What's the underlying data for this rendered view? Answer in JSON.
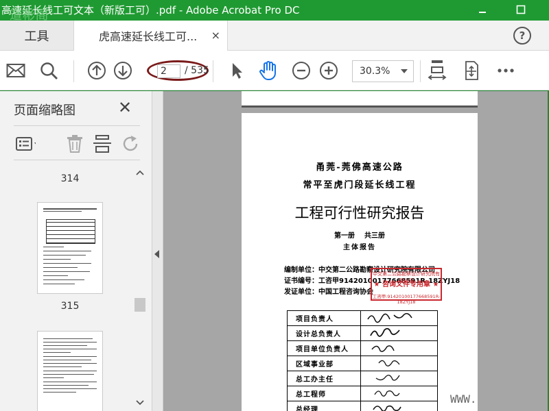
{
  "window": {
    "title": "高速延长线工可文本（新版工可）.pdf - Adobe Acrobat Pro DC",
    "watermark": "道彬阁",
    "minimize_icon": "minimize-icon",
    "maximize_icon": "maximize-icon"
  },
  "tabs": {
    "tools_label": "工具",
    "doc_label": "虎高速延长线工可...",
    "close_glyph": "×",
    "help_glyph": "?"
  },
  "toolbar": {
    "page_current": "2",
    "page_total": "/ 535",
    "zoom": "30.3%",
    "icons": [
      "mail-icon",
      "search-icon",
      "prev-page-icon",
      "next-page-icon",
      "select-cursor-icon",
      "hand-tool-icon",
      "zoom-out-icon",
      "zoom-in-icon",
      "fit-width-icon",
      "full-screen-icon",
      "more-icon"
    ],
    "accent": "#1473e6"
  },
  "sidebar": {
    "title": "页面缩略图",
    "close_glyph": "✕",
    "tools": [
      "options-icon",
      "delete-icon",
      "extract-icon",
      "rotate-icon"
    ],
    "pages": [
      {
        "label": "314"
      },
      {
        "label": "315"
      }
    ]
  },
  "document": {
    "line1": "甬莞-莞佛高速公路",
    "line2": "常平至虎门段延长线工程",
    "heading": "工程可行性研究报告",
    "volume": "第一册    共三册",
    "subtitle": "主体报告",
    "info": [
      "编制单位：中交第二公路勘察设计研究院有限公司",
      "证书编号：工咨甲91420100177668591R-18ZYJ18",
      "发证单位：中国工程咨询协会"
    ],
    "stamp": {
      "top": "中交第二公路勘察设计研究院有限公司",
      "mid": "★ 咨询文件专用章 ★",
      "bot": "工咨甲:91420100177668591R-18ZYJ18",
      "color": "#c9272d"
    },
    "roles": [
      "项目负责人",
      "设计总负责人",
      "项目单位负责人",
      "区域事业部",
      "总工办主任",
      "总工程师",
      "总经理"
    ],
    "site_watermark": "WWW."
  }
}
